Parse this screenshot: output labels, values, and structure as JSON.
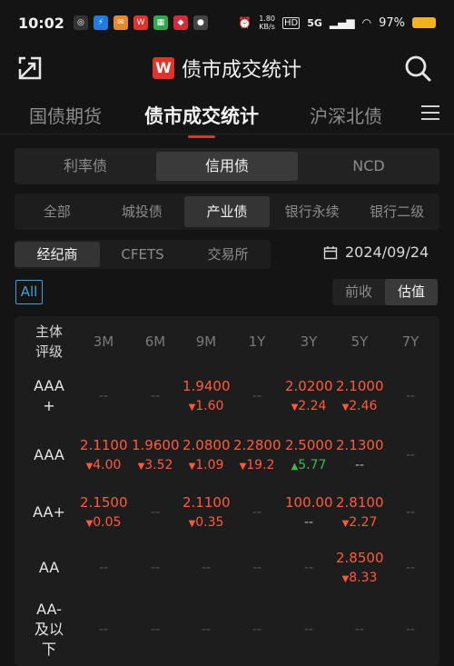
{
  "status": {
    "time": "10:02",
    "net_speed_value": "1.80",
    "net_speed_unit": "KB/s",
    "network": "5G",
    "battery": "97%"
  },
  "header": {
    "logo_letter": "W",
    "title": "债市成交统计"
  },
  "main_tabs": [
    "国债期货",
    "债市成交统计",
    "沪深北债"
  ],
  "bond_types": [
    "利率债",
    "信用债",
    "NCD"
  ],
  "sub_categories": [
    "全部",
    "城投债",
    "产业债",
    "银行永续",
    "银行二级"
  ],
  "sources": [
    "经纪商",
    "CFETS",
    "交易所"
  ],
  "date": "2024/09/24",
  "filter_all": "All",
  "modes": [
    "前收",
    "估值"
  ],
  "table": {
    "rating_header": [
      "主体",
      "评级"
    ],
    "columns": [
      "3M",
      "6M",
      "9M",
      "1Y",
      "3Y",
      "5Y",
      "7Y"
    ],
    "dash": "--",
    "rows": [
      {
        "rating": [
          "AAA",
          "+"
        ],
        "cells": [
          null,
          null,
          {
            "val": "1.9400",
            "chg": "1.60",
            "dir": "down"
          },
          null,
          {
            "val": "2.0200",
            "chg": "2.24",
            "dir": "down"
          },
          {
            "val": "2.1000",
            "chg": "2.46",
            "dir": "down"
          },
          null
        ]
      },
      {
        "rating": [
          "AAA"
        ],
        "cells": [
          {
            "val": "2.1100",
            "chg": "4.00",
            "dir": "down"
          },
          {
            "val": "1.9600",
            "chg": "3.52",
            "dir": "down"
          },
          {
            "val": "2.0800",
            "chg": "1.09",
            "dir": "down"
          },
          {
            "val": "2.2800",
            "chg": "19.2",
            "dir": "down"
          },
          {
            "val": "2.5000",
            "chg": "5.77",
            "dir": "up"
          },
          {
            "val": "2.1300",
            "chg": "--",
            "dir": "flat"
          },
          null
        ]
      },
      {
        "rating": [
          "AA+"
        ],
        "cells": [
          {
            "val": "2.1500",
            "chg": "0.05",
            "dir": "down"
          },
          null,
          {
            "val": "2.1100",
            "chg": "0.35",
            "dir": "down"
          },
          null,
          {
            "val": "100.00",
            "chg": "--",
            "dir": "flat"
          },
          {
            "val": "2.8100",
            "chg": "2.27",
            "dir": "down"
          },
          null
        ]
      },
      {
        "rating": [
          "AA"
        ],
        "cells": [
          null,
          null,
          null,
          null,
          null,
          {
            "val": "2.8500",
            "chg": "8.33",
            "dir": "down"
          },
          null
        ]
      },
      {
        "rating": [
          "AA-",
          "及以",
          "下"
        ],
        "cells": [
          null,
          null,
          null,
          null,
          null,
          null,
          null
        ]
      }
    ]
  },
  "colors": {
    "accent_red": "#e0332a",
    "value_red": "#ff5a3c",
    "up_green": "#3fb950",
    "all_blue": "#4a9fd0"
  }
}
